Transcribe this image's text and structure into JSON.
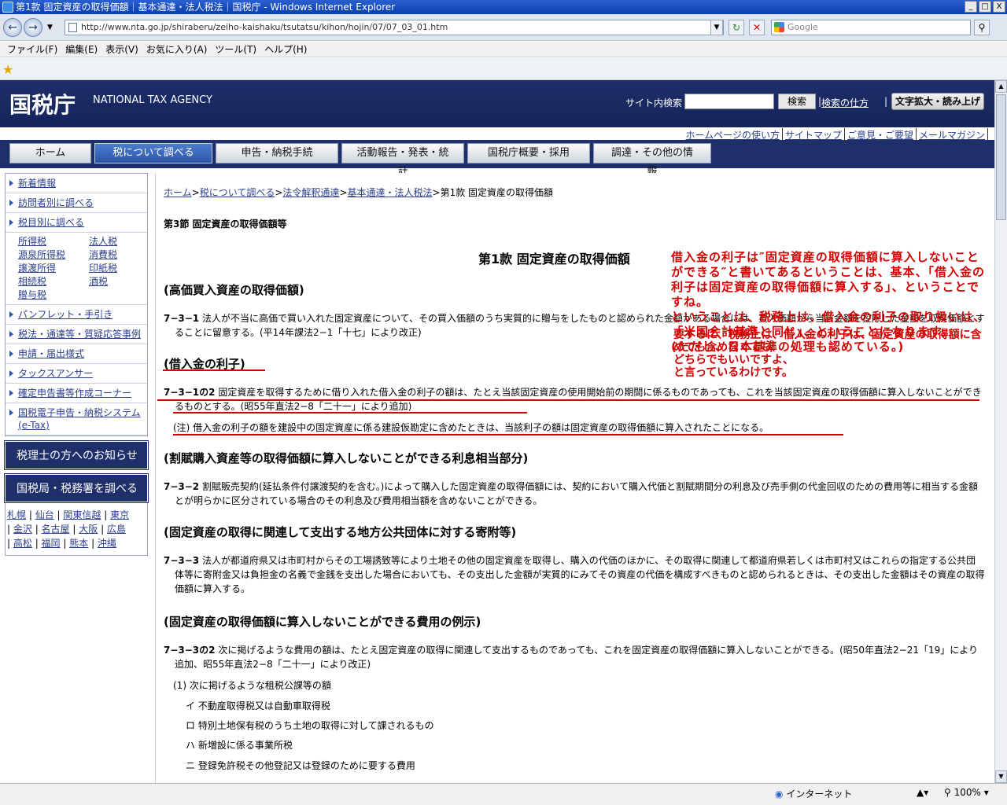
{
  "window": {
    "title": "第1款 固定資産の取得価額｜基本通達・法人税法｜国税庁 - Windows Internet Explorer",
    "min": "_",
    "max": "□",
    "close": "X"
  },
  "browser": {
    "url": "http://www.nta.go.jp/shiraberu/zeiho-kaishaku/tsutatsu/kihon/hojin/07/07_03_01.htm",
    "search_placeholder": "Google",
    "menus": [
      "ファイル(F)",
      "編集(E)",
      "表示(V)",
      "お気に入り(A)",
      "ツール(T)",
      "ヘルプ(H)"
    ],
    "back_icon": "arrow-left-icon",
    "forward_icon": "arrow-right-icon"
  },
  "header": {
    "logo_kanji": "国税庁",
    "logo_en": "NATIONAL TAX AGENCY",
    "search_label": "サイト内検索",
    "search_button": "検索",
    "search_help": "検索の仕方",
    "text_size": "文字拡大・読み上げ",
    "util_links": [
      "ホームページの使い方",
      "サイトマップ",
      "ご意見・ご要望",
      "メールマガジン"
    ]
  },
  "nav": {
    "items": [
      "ホーム",
      "税について調べる",
      "申告・納税手続",
      "活動報告・発表・統計",
      "国税庁概要・採用",
      "調達・その他の情報"
    ],
    "active_index": 1
  },
  "sidebar": {
    "links1": [
      "新着情報",
      "訪問者別に調べる",
      "税目別に調べる"
    ],
    "taxes": [
      "所得税",
      "法人税",
      "源泉所得税",
      "消費税",
      "譲渡所得",
      "印紙税",
      "相続税",
      "酒税",
      "贈与税"
    ],
    "links2": [
      "パンフレット・手引き",
      "税法・通達等・質疑応答事例",
      "申請・届出様式",
      "タックスアンサー",
      "確定申告書等作成コーナー",
      "国税電子申告・納税システム(e-Tax)"
    ],
    "box1": "税理士の方へのお知らせ",
    "box2": "国税局・税務署を調べる",
    "cities": [
      [
        "札幌",
        "仙台",
        "関東信越",
        "東京"
      ],
      [
        "金沢",
        "名古屋",
        "大阪",
        "広島"
      ],
      [
        "高松",
        "福岡",
        "熊本",
        "沖縄"
      ]
    ]
  },
  "main": {
    "breadcrumb": [
      "ホーム",
      "税について調べる",
      "法令解釈通達",
      "基本通達・法人税法"
    ],
    "breadcrumb_current": "第1款 固定資産の取得価額",
    "section": "第3節 固定資産の取得価額等",
    "kan": "第1款 固定資産の取得価額",
    "h_1": "(高価買入資産の取得価額)",
    "p_731_num": "7−3−1",
    "p_731": "法人が不当に高価で買い入れた固定資産について、その買入価額のうち実質的に贈与をしたものと認められた金額がある場合には、買入価額から当該金額を控除した金額を取得価額とすることに留意する。(平14年課法2−1「十七」により改正)",
    "h_2": "(借入金の利子)",
    "p_7312_num": "7−3−1の2",
    "p_7312": "固定資産を取得するために借り入れた借入金の利子の額は、たとえ当該固定資産の使用開始前の期間に係るものであっても、これを当該固定資産の取得価額に算入しないことができるものとする。(昭55年直法2−8「二十一」により追加)",
    "note_7312": "(注) 借入金の利子の額を建設中の固定資産に係る建設仮勘定に含めたときは、当該利子の額は固定資産の取得価額に算入されたことになる。",
    "h_3": "(割賦購入資産等の取得価額に算入しないことができる利息相当部分)",
    "p_732_num": "7−3−2",
    "p_732": "割賦販売契約(延払条件付譲渡契約を含む。)によって購入した固定資産の取得価額には、契約において購入代価と割賦期間分の利息及び売手側の代金回収のための費用等に相当する金額とが明らかに区分されている場合のその利息及び費用相当額を含めないことができる。",
    "h_4": "(固定資産の取得に関連して支出する地方公共団体に対する寄附等)",
    "p_733_num": "7−3−3",
    "p_733": "法人が都道府県又は市町村からその工場誘致等により土地その他の固定資産を取得し、購入の代価のほかに、その取得に関連して都道府県若しくは市町村又はこれらの指定する公共団体等に寄附金又は負担金の名義で金銭を支出した場合においても、その支出した金額が実質的にみてその資産の代価を構成すべきものと認められるときは、その支出した金額はその資産の取得価額に算入する。",
    "h_5": "(固定資産の取得価額に算入しないことができる費用の例示)",
    "p_7332_num": "7−3−3の2",
    "p_7332": "次に掲げるような費用の額は、たとえ固定資産の取得に関連して支出するものであっても、これを固定資産の取得価額に算入しないことができる。(昭50年直法2−21「19」により追加、昭55年直法2−8「二十一」により改正)",
    "sub_1": "(1) 次に掲げるような租税公課等の額",
    "sub_items": [
      "イ 不動産取得税又は自動車取得税",
      "ロ 特別土地保有税のうち土地の取得に対して課されるもの",
      "ハ 新増設に係る事業所税",
      "ニ 登録免許税その他登記又は登録のために要する費用"
    ]
  },
  "annotation": {
    "a1": "借入金の利子は″固定資産の取得価額に算入しないことができる″と書いてあるということは、基本、「借入金の利子は固定資産の取得価額に算入する」、ということですね。",
    "a2": "ということは、税務上は、借入金の利子の取り扱いは、「米国会計基準と同じ」、ということになります。",
    "a3": "(ただし、日本基準の処理も認めている。)",
    "b1": "要するに、税務上は、借入金の利子は、固定資産の取得額に含めても含めなくても、",
    "b2": "どちらでもいいですよ、",
    "b3": "と言っているわけです。",
    "color": "#d40000"
  },
  "status": {
    "zone": "インターネット",
    "zoom": "100%"
  }
}
